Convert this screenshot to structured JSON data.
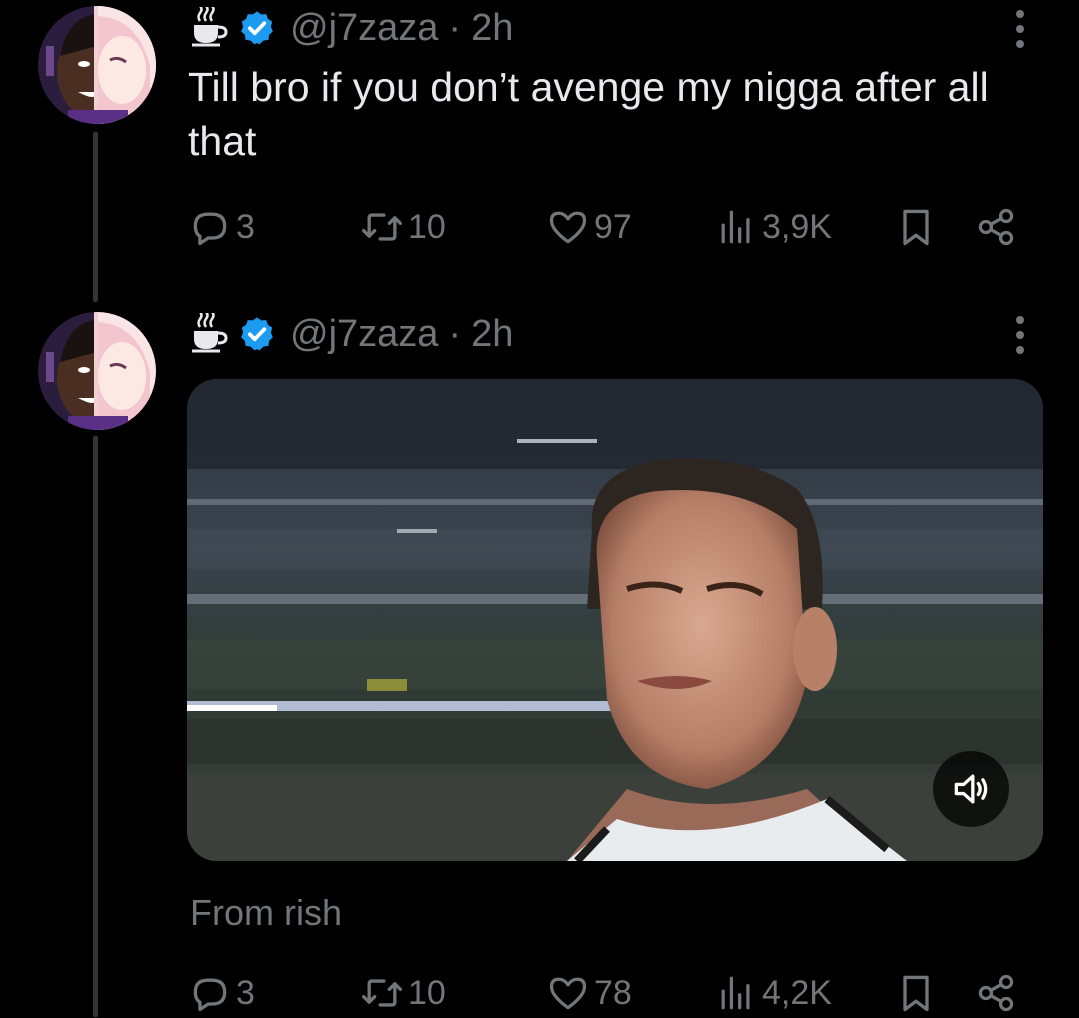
{
  "tweets": [
    {
      "handle": "@j7zaza",
      "separator": "·",
      "time": "2h",
      "text": "Till bro if you don’t avenge my nigga after all that",
      "stats": {
        "replies": "3",
        "retweets": "10",
        "likes": "97",
        "views": "3,9K"
      }
    },
    {
      "handle": "@j7zaza",
      "separator": "·",
      "time": "2h",
      "media_type": "video",
      "caption": "From rish",
      "stats": {
        "replies": "3",
        "retweets": "10",
        "likes": "78",
        "views": "4,2K"
      }
    }
  ],
  "icons": {
    "name_emoji": "hot-beverage-icon",
    "verified": "verified-badge-icon",
    "more": "more-icon",
    "reply": "reply-icon",
    "retweet": "retweet-icon",
    "like": "heart-icon",
    "views": "views-icon",
    "bookmark": "bookmark-icon",
    "share": "share-icon",
    "volume": "volume-icon"
  },
  "colors": {
    "background": "#000000",
    "text": "#e7e9ea",
    "muted": "#71767b",
    "verified": "#1d9bf0"
  }
}
